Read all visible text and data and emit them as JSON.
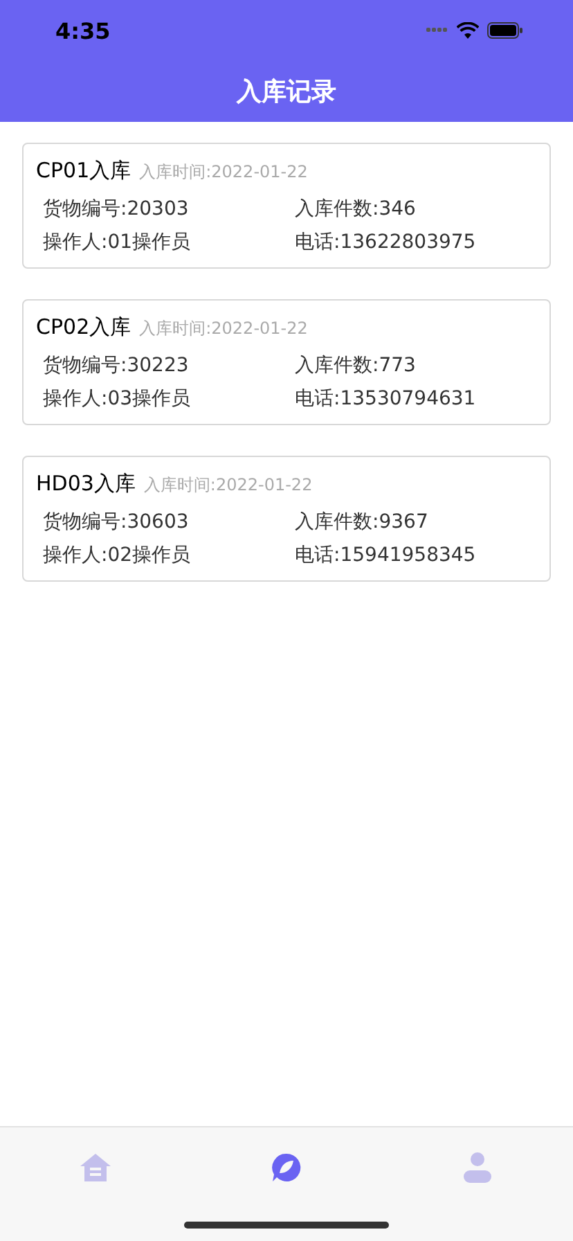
{
  "status_bar": {
    "time": "4:35"
  },
  "nav": {
    "title": "入库记录"
  },
  "records": [
    {
      "title": "CP01入库",
      "time": "入库时间:2022-01-22",
      "goods_no": "货物编号:20303",
      "count": "入库件数:346",
      "operator": "操作人:01操作员",
      "phone": "电话:13622803975"
    },
    {
      "title": "CP02入库",
      "time": "入库时间:2022-01-22",
      "goods_no": "货物编号:30223",
      "count": "入库件数:773",
      "operator": "操作人:03操作员",
      "phone": "电话:13530794631"
    },
    {
      "title": "HD03入库",
      "time": "入库时间:2022-01-22",
      "goods_no": "货物编号:30603",
      "count": "入库件数:9367",
      "operator": "操作人:02操作员",
      "phone": "电话:15941958345"
    }
  ],
  "tabs": [
    {
      "kind": "home",
      "selected": false
    },
    {
      "kind": "discover",
      "selected": true
    },
    {
      "kind": "profile",
      "selected": false
    }
  ]
}
